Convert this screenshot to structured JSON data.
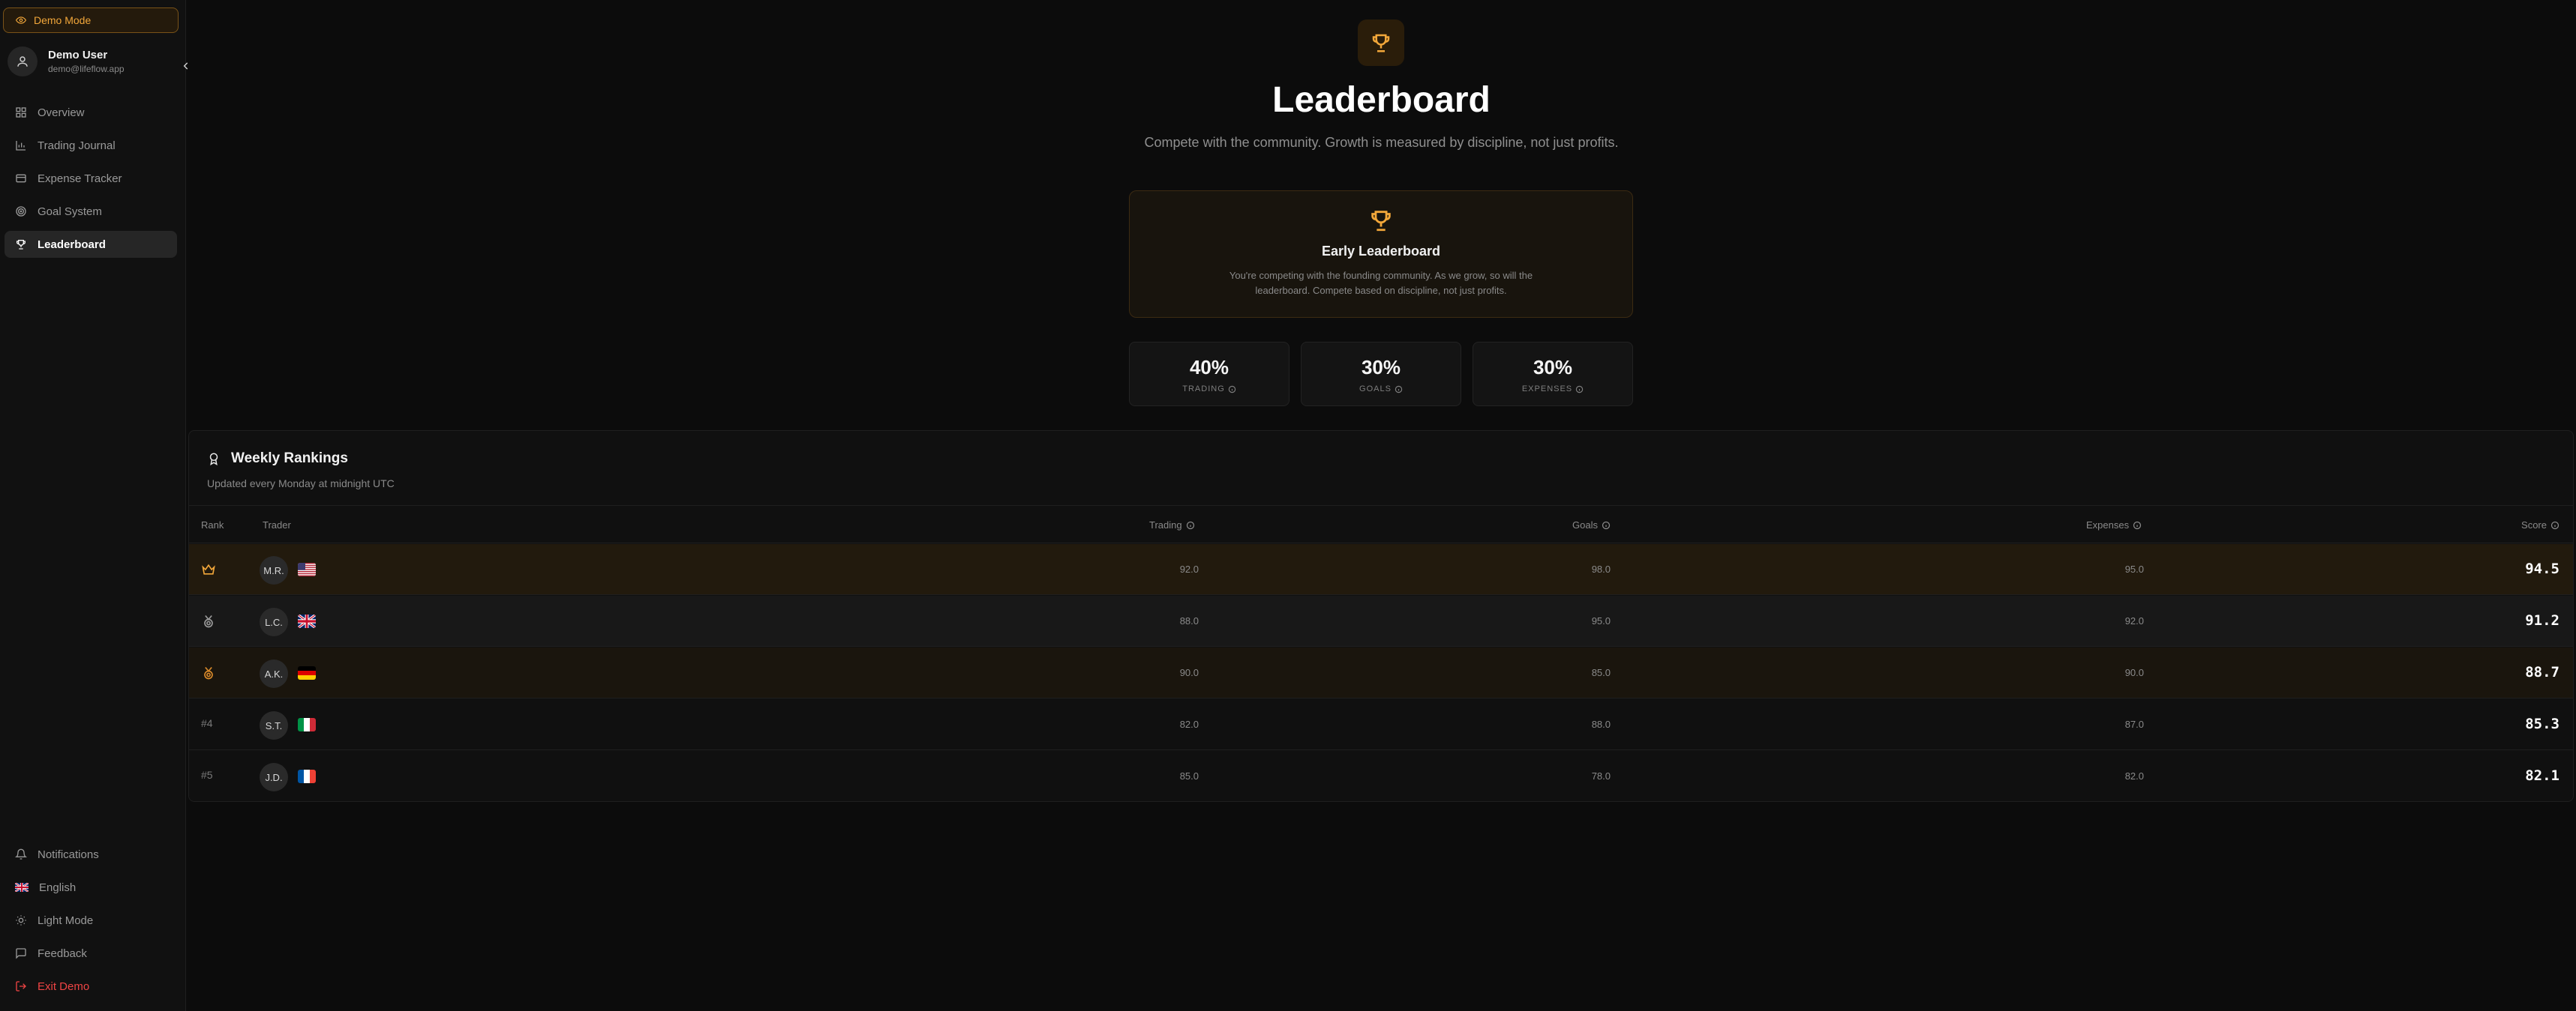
{
  "sidebar": {
    "demo_badge": "Demo Mode",
    "user": {
      "name": "Demo User",
      "email": "demo@lifeflow.app"
    },
    "items": [
      {
        "label": "Overview",
        "icon": "grid-icon"
      },
      {
        "label": "Trading Journal",
        "icon": "chart-icon"
      },
      {
        "label": "Expense Tracker",
        "icon": "receipt-icon"
      },
      {
        "label": "Goal System",
        "icon": "target-icon"
      },
      {
        "label": "Leaderboard",
        "icon": "trophy-icon",
        "active": true
      }
    ],
    "bottom": {
      "notifications": "Notifications",
      "language": "English",
      "theme": "Light Mode",
      "feedback": "Feedback",
      "exit": "Exit Demo"
    }
  },
  "header": {
    "title": "Leaderboard",
    "subtitle": "Compete with the community. Growth is measured by discipline, not just profits."
  },
  "early": {
    "title": "Early Leaderboard",
    "description": "You're competing with the founding community. As we grow, so will the leaderboard. Compete based on discipline, not just profits."
  },
  "weights": [
    {
      "pct": "40%",
      "label": "TRADING"
    },
    {
      "pct": "30%",
      "label": "GOALS"
    },
    {
      "pct": "30%",
      "label": "EXPENSES"
    }
  ],
  "rankings": {
    "title": "Weekly Rankings",
    "subtitle": "Updated every Monday at midnight UTC",
    "columns": {
      "rank": "Rank",
      "trader": "Trader",
      "trading": "Trading",
      "goals": "Goals",
      "expenses": "Expenses",
      "score": "Score"
    },
    "rows": [
      {
        "rank": "",
        "initials": "M.R.",
        "country": "US",
        "trading": "92.0",
        "goals": "98.0",
        "expenses": "95.0",
        "score": "94.5"
      },
      {
        "rank": "",
        "initials": "L.C.",
        "country": "GB",
        "trading": "88.0",
        "goals": "95.0",
        "expenses": "92.0",
        "score": "91.2"
      },
      {
        "rank": "",
        "initials": "A.K.",
        "country": "DE",
        "trading": "90.0",
        "goals": "85.0",
        "expenses": "90.0",
        "score": "88.7"
      },
      {
        "rank": "#4",
        "initials": "S.T.",
        "country": "IT",
        "trading": "82.0",
        "goals": "88.0",
        "expenses": "87.0",
        "score": "85.3"
      },
      {
        "rank": "#5",
        "initials": "J.D.",
        "country": "FR",
        "trading": "85.0",
        "goals": "78.0",
        "expenses": "82.0",
        "score": "82.1"
      }
    ]
  },
  "colors": {
    "accent": "#f2a73a",
    "danger": "#ef4444",
    "background": "#0c0c0c"
  }
}
